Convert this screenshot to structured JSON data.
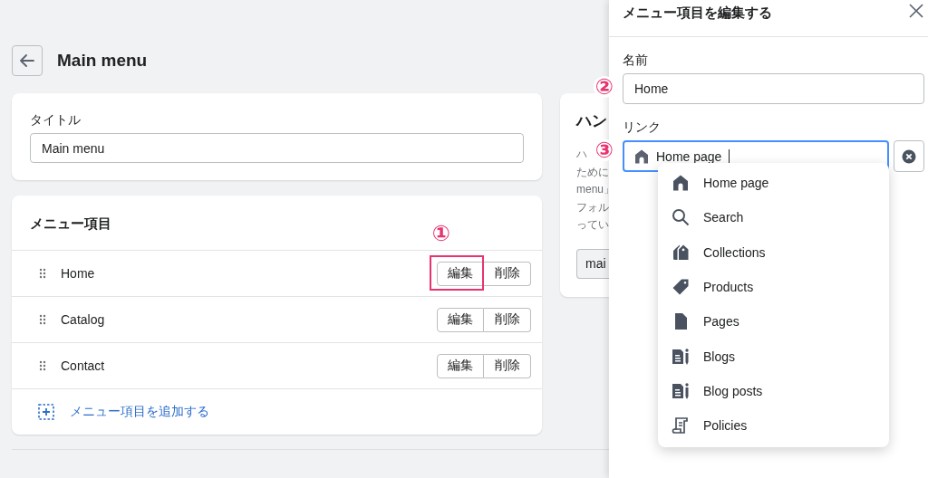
{
  "page": {
    "title": "Main menu"
  },
  "title_card": {
    "label": "タイトル",
    "value": "Main menu"
  },
  "menu_card": {
    "heading": "メニュー項目",
    "items": [
      {
        "name": "Home",
        "edit": "編集",
        "delete": "削除",
        "highlighted": true
      },
      {
        "name": "Catalog",
        "edit": "編集",
        "delete": "削除",
        "highlighted": false
      },
      {
        "name": "Contact",
        "edit": "編集",
        "delete": "削除",
        "highlighted": false
      }
    ],
    "add_link": "メニュー項目を追加する"
  },
  "handle_card": {
    "title": "ハン",
    "lines": [
      "ハ",
      "ために",
      "menu」",
      "フォル",
      "ってい"
    ],
    "button": "mai"
  },
  "drawer": {
    "title": "メニュー項目を編集する",
    "name_label": "名前",
    "name_value": "Home",
    "link_label": "リンク",
    "link_value": "Home page",
    "link_focused": true,
    "options": [
      {
        "label": "Home page",
        "kind": "home"
      },
      {
        "label": "Search",
        "kind": "search"
      },
      {
        "label": "Collections",
        "kind": "collections"
      },
      {
        "label": "Products",
        "kind": "product"
      },
      {
        "label": "Pages",
        "kind": "page"
      },
      {
        "label": "Blogs",
        "kind": "blog"
      },
      {
        "label": "Blog posts",
        "kind": "blog"
      },
      {
        "label": "Policies",
        "kind": "policy"
      }
    ]
  },
  "annotations": [
    {
      "label": "①"
    },
    {
      "label": "②"
    },
    {
      "label": "③"
    }
  ]
}
